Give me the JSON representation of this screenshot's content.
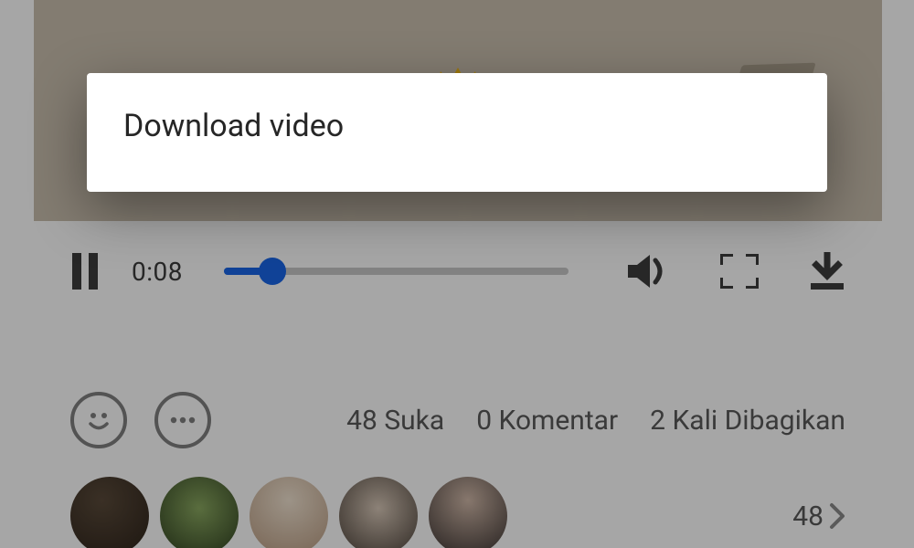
{
  "modal": {
    "download_label": "Download video"
  },
  "player": {
    "time_elapsed": "0:08",
    "progress_percent": 14
  },
  "social": {
    "likes_label": "48 Suka",
    "comments_label": "0 Komentar",
    "shares_label": "2 Kali Dibagikan",
    "more_count": "48"
  },
  "icons": {
    "pause": "pause-icon",
    "volume": "volume-icon",
    "fullscreen": "fullscreen-icon",
    "download": "download-icon",
    "smiley": "smiley-icon",
    "comment_bubble": "comment-bubble-icon",
    "chevron_right": "chevron-right-icon"
  },
  "colors": {
    "accent": "#1a66e8",
    "icon": "#3c3c3c",
    "text_muted": "#5a5a5a"
  }
}
